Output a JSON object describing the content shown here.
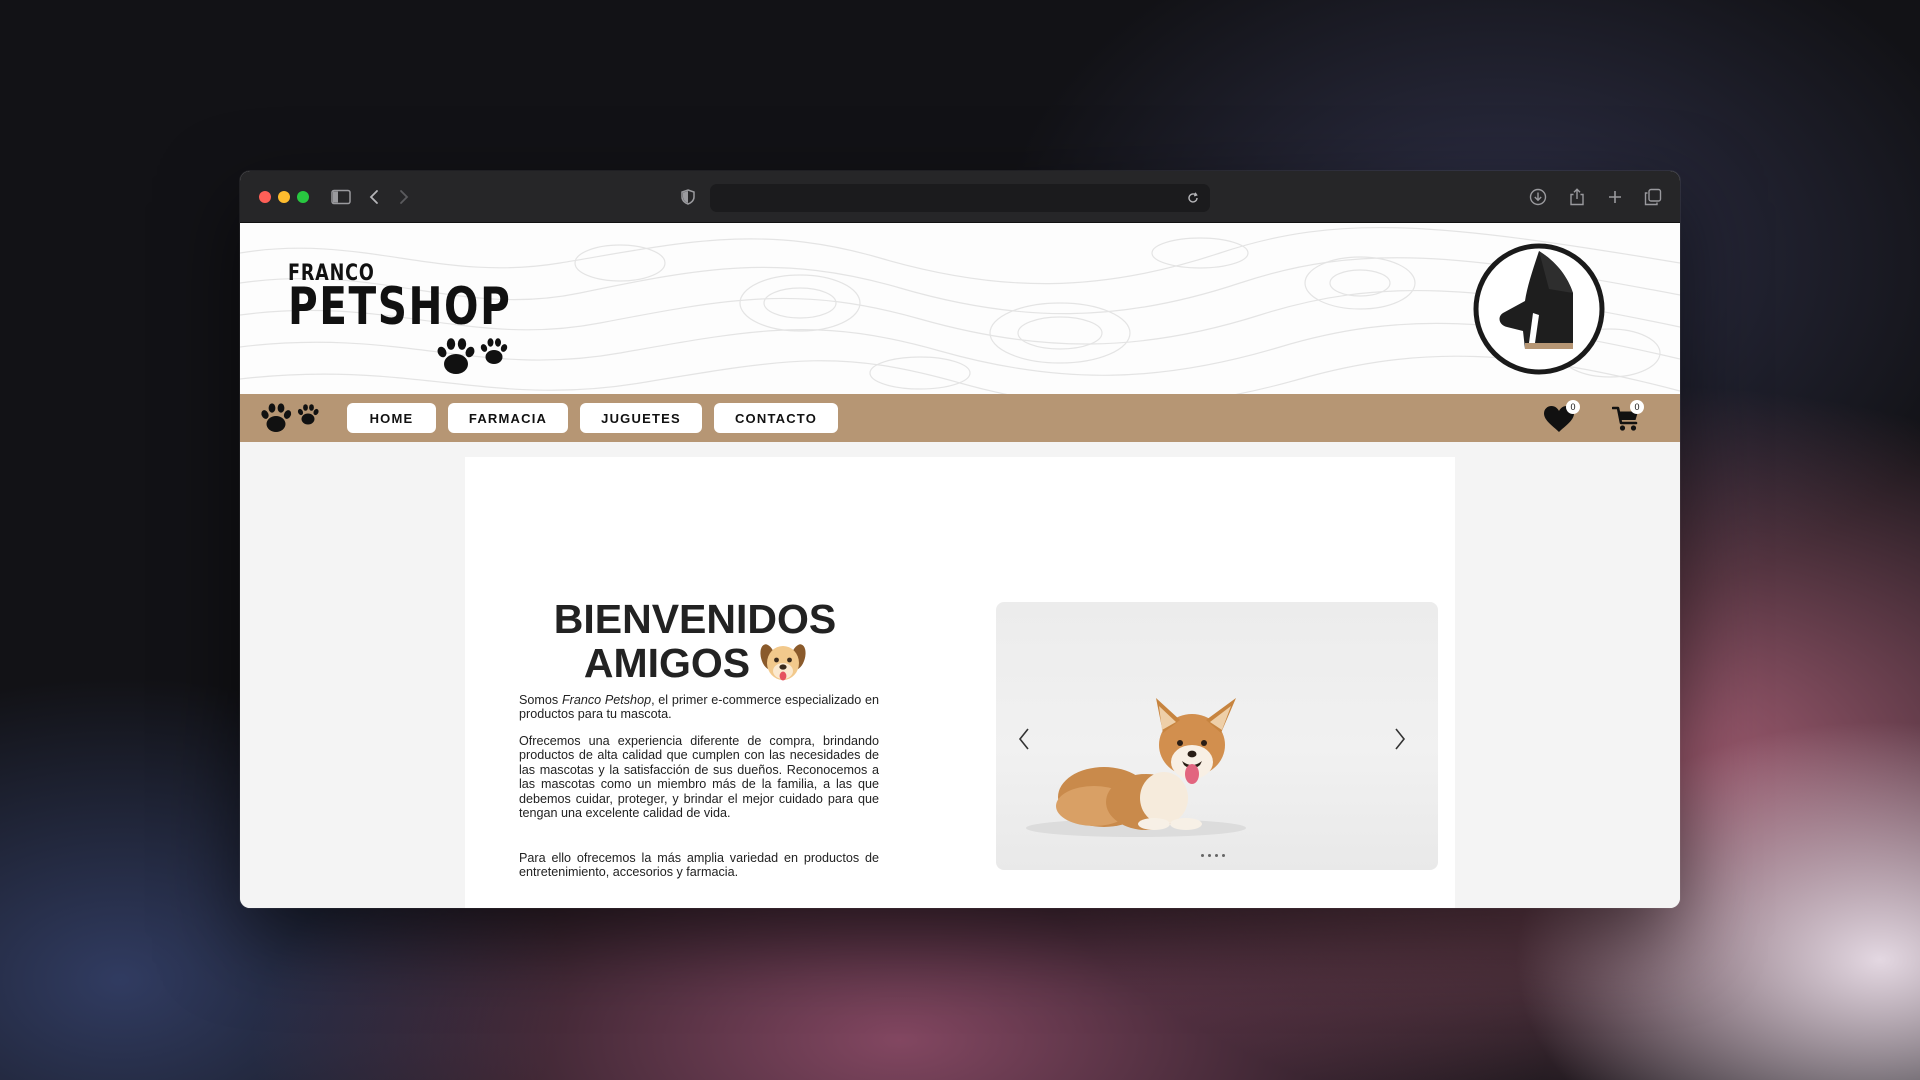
{
  "browser": {
    "url": "",
    "icons": [
      "sidebar-icon",
      "back-icon",
      "forward-icon",
      "shield-icon",
      "reload-icon",
      "download-icon",
      "share-icon",
      "new-tab-icon",
      "tabs-icon"
    ]
  },
  "header": {
    "logo_top": "FRANCO",
    "logo_main": "PETSHOP"
  },
  "nav": {
    "items": [
      {
        "label": "HOME"
      },
      {
        "label": "FARMACIA"
      },
      {
        "label": "JUGUETES"
      },
      {
        "label": "CONTACTO"
      }
    ],
    "favorites_count": "0",
    "cart_count": "0"
  },
  "main": {
    "title_line1": "BIENVENIDOS",
    "title_line2": "AMIGOS",
    "intro_prefix": "Somos ",
    "intro_brand": "Franco Petshop",
    "intro_suffix": ", el primer e-commerce especializado en productos para tu mascota.",
    "paragraph2": "Ofrecemos una experiencia diferente de compra, brindando productos de alta calidad que cumplen con las necesidades de las mascotas y la satisfacción de sus dueños. Reconocemos a las mascotas como un miembro más de la familia, a las que debemos cuidar, proteger, y brindar el mejor cuidado para que tengan una excelente calidad de vida.",
    "paragraph3": "Para ello ofrecemos la más amplia variedad en productos de entretenimiento, accesorios y farmacia."
  },
  "carousel": {
    "slide_count": 4,
    "active_slide": 1
  },
  "colors": {
    "nav_bg": "#b69674",
    "accent_gold": "#b69674",
    "text_dark": "#222222"
  }
}
